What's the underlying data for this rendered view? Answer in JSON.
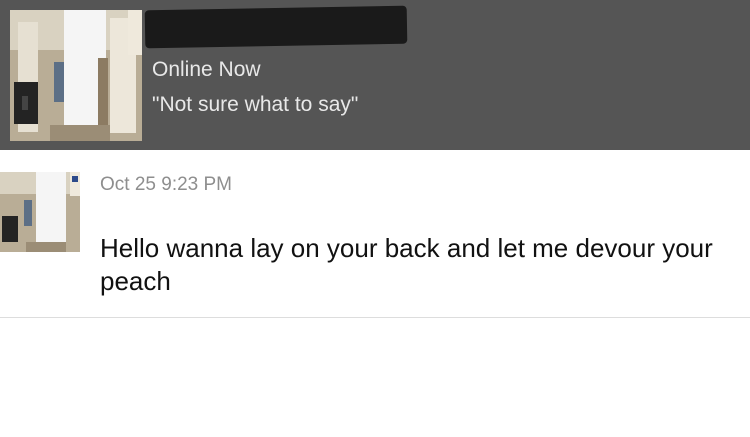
{
  "profile": {
    "status": "Online Now",
    "quote": "\"Not sure what to say\""
  },
  "message": {
    "timestamp": "Oct 25 9:23 PM",
    "text": "Hello wanna lay on your back and let me devour your peach"
  },
  "colors": {
    "header_bg": "#555555",
    "header_text": "#e8e8e8",
    "timestamp": "#8e8e8e",
    "message_text": "#111111",
    "redaction": "#1a1a1a"
  }
}
